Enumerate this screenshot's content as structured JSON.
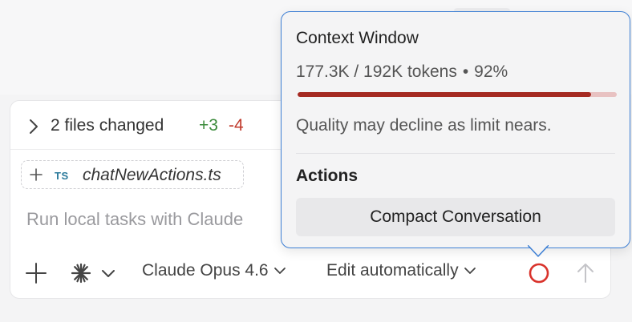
{
  "changes": {
    "summary": "2 files changed",
    "added": "+3",
    "removed": "-4"
  },
  "attachment": {
    "type_badge": "TS",
    "filename": "chatNewActions.ts"
  },
  "prompt": {
    "placeholder": "Run local tasks with Claude"
  },
  "toolbar": {
    "model_label": "Claude Opus 4.6",
    "edit_mode_label": "Edit automatically",
    "icons": [
      "plus-icon",
      "asterisk-icon",
      "chevron-down-icon",
      "context-ring-icon",
      "arrow-up-icon"
    ]
  },
  "context_popover": {
    "title": "Context Window",
    "usage_tokens": "177.3K / 192K tokens",
    "separator": "•",
    "usage_percent": "92%",
    "usage_fraction": 0.92,
    "warning": "Quality may decline as limit nears.",
    "actions_heading": "Actions",
    "compact_button": "Compact Conversation"
  },
  "colors": {
    "added": "#3a8a3a",
    "removed": "#c0392b",
    "progress_fill": "#a52a22",
    "progress_track": "#e8c2c2",
    "popover_border": "#3d7fd4",
    "ring": "#d9322b"
  }
}
